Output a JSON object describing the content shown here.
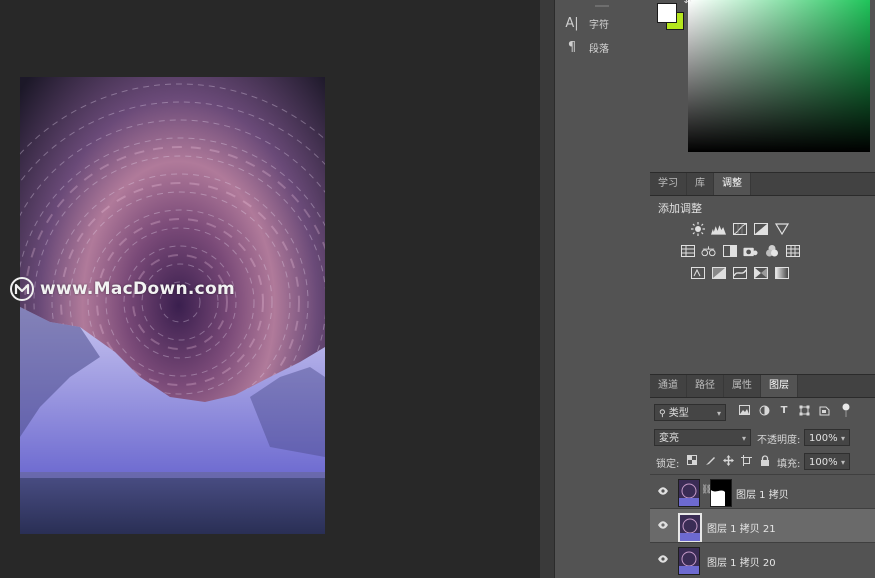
{
  "mini_panels": {
    "items": [
      {
        "icon": "character-icon",
        "glyph": "A|",
        "label": "字符"
      },
      {
        "icon": "paragraph-icon",
        "glyph": "¶",
        "label": "段落"
      }
    ]
  },
  "top_tabs": [
    "学习",
    "库",
    "调整"
  ],
  "adjustments": {
    "title": "添加调整"
  },
  "layer_tabs": [
    "通道",
    "路径",
    "属性",
    "图层"
  ],
  "layers_panel": {
    "filter_kind": "类型",
    "blend_mode": "変亮",
    "opacity_label": "不透明度:",
    "opacity_value": "100%",
    "lock_label": "锁定:",
    "fill_label": "填充:",
    "fill_value": "100%",
    "layers": [
      {
        "name": "图层 1 拷贝",
        "visible": true,
        "has_mask": true,
        "selected": false
      },
      {
        "name": "图层 1 拷贝 21",
        "visible": true,
        "has_mask": false,
        "selected": true
      },
      {
        "name": "图层 1 拷贝 20",
        "visible": true,
        "has_mask": false,
        "selected": false
      }
    ]
  },
  "watermark": {
    "text": "www.MacDown.com"
  },
  "colors": {
    "foreground": "#ffffff",
    "background": "#b5e61d",
    "picker_hue": "#1fc45a",
    "app_bg": "#282828",
    "panel_bg": "#535353"
  }
}
